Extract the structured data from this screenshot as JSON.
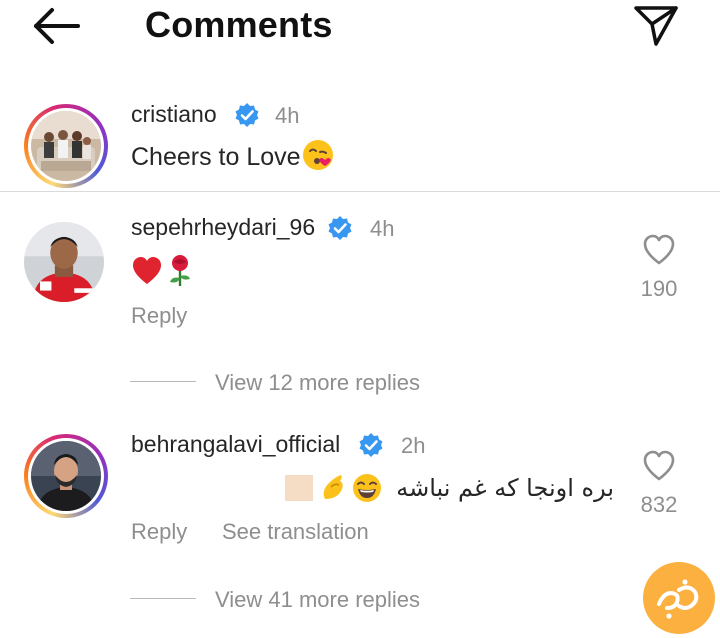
{
  "header": {
    "title": "Comments",
    "back_icon": "arrow-left-icon",
    "send_icon": "paper-plane-icon"
  },
  "caption": {
    "username": "cristiano",
    "time": "4h",
    "text": "Cheers to Love"
  },
  "comments": [
    {
      "username": "sepehrheydari_96",
      "time": "4h",
      "likes": "190",
      "reply_label": "Reply",
      "view_replies": "View 12 more replies"
    },
    {
      "username": "behrangalavi_official",
      "time": "2h",
      "text": "بره اونجا که غم نباشه",
      "likes": "832",
      "reply_label": "Reply",
      "see_translation": "See translation",
      "view_replies": "View 41 more replies"
    }
  ],
  "colors": {
    "verified_blue": "#3897f0",
    "muted_text": "#8e8e8e",
    "heart_red": "#e0242f"
  }
}
